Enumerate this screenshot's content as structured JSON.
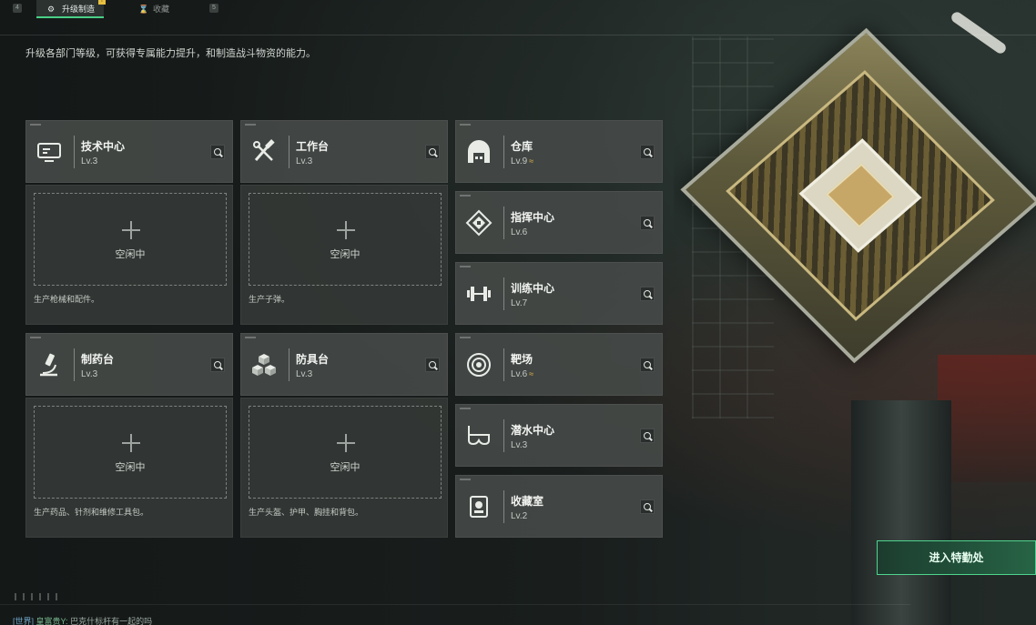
{
  "tabs": [
    {
      "key": "4",
      "label": ""
    },
    {
      "label": "升级制造",
      "active": true
    },
    {
      "label": "收藏",
      "active": false
    },
    {
      "key": "5",
      "label": ""
    }
  ],
  "subtitle": "升级各部门等级，可获得专属能力提升，和制造战斗物资的能力。",
  "enter_button": "进入特勤处",
  "left_departments": [
    {
      "name": "技术中心",
      "level": "Lv.3",
      "icon": "monitor-icon",
      "slot_status": "空闲中",
      "desc": "生产枪械和配件。"
    },
    {
      "name": "工作台",
      "level": "Lv.3",
      "icon": "tools-icon",
      "slot_status": "空闲中",
      "desc": "生产子弹。"
    },
    {
      "name": "制药台",
      "level": "Lv.3",
      "icon": "microscope-icon",
      "slot_status": "空闲中",
      "desc": "生产药品、针剂和维修工具包。"
    },
    {
      "name": "防具台",
      "level": "Lv.3",
      "icon": "cubes-icon",
      "slot_status": "空闲中",
      "desc": "生产头盔、护甲、胸挂和背包。"
    }
  ],
  "right_departments": [
    {
      "name": "仓库",
      "level": "Lv.9",
      "upgrade": true,
      "icon": "warehouse-icon"
    },
    {
      "name": "指挥中心",
      "level": "Lv.6",
      "upgrade": false,
      "icon": "command-icon"
    },
    {
      "name": "训练中心",
      "level": "Lv.7",
      "upgrade": false,
      "icon": "dumbbell-icon"
    },
    {
      "name": "靶场",
      "level": "Lv.6",
      "upgrade": true,
      "icon": "target-icon"
    },
    {
      "name": "潜水中心",
      "level": "Lv.3",
      "upgrade": false,
      "icon": "diving-mask-icon"
    },
    {
      "name": "收藏室",
      "level": "Lv.2",
      "upgrade": false,
      "icon": "collection-icon"
    }
  ],
  "upgrade_glyph": "≈",
  "chat": {
    "channel": "[世界]",
    "sender": "皇富贵Y:",
    "message": "巴克什标杆有一起的吗"
  },
  "colors": {
    "accent": "#49d087",
    "upgrade": "#e2b64a",
    "card": "#444947"
  }
}
